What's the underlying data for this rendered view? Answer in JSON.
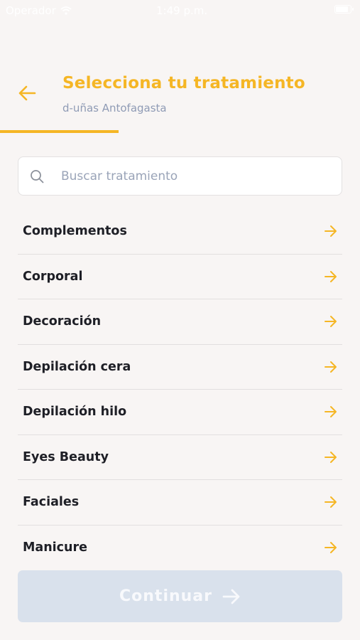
{
  "status_bar": {
    "carrier": "Operador",
    "time": "1:49 p.m.",
    "battery_level": 0.85
  },
  "header": {
    "back_icon": "arrow-left-icon",
    "title": "Selecciona tu tratamiento",
    "subtitle": "d-uñas Antofagasta",
    "progress": 0.33
  },
  "search": {
    "placeholder": "Buscar tratamiento",
    "value": "",
    "icon": "search-icon"
  },
  "categories": [
    {
      "label": "Complementos"
    },
    {
      "label": "Corporal"
    },
    {
      "label": "Decoración"
    },
    {
      "label": "Depilación cera"
    },
    {
      "label": "Depilación hilo"
    },
    {
      "label": "Eyes Beauty"
    },
    {
      "label": "Faciales"
    },
    {
      "label": "Manicure"
    }
  ],
  "continue_button": {
    "label": "Continuar",
    "icon": "arrow-right-icon",
    "enabled": false
  },
  "colors": {
    "accent": "#f5b625",
    "background": "#f8f5f4",
    "text": "#1e1f26",
    "subtitle": "#8f9bb5",
    "button_disabled": "#d9e1ec"
  }
}
